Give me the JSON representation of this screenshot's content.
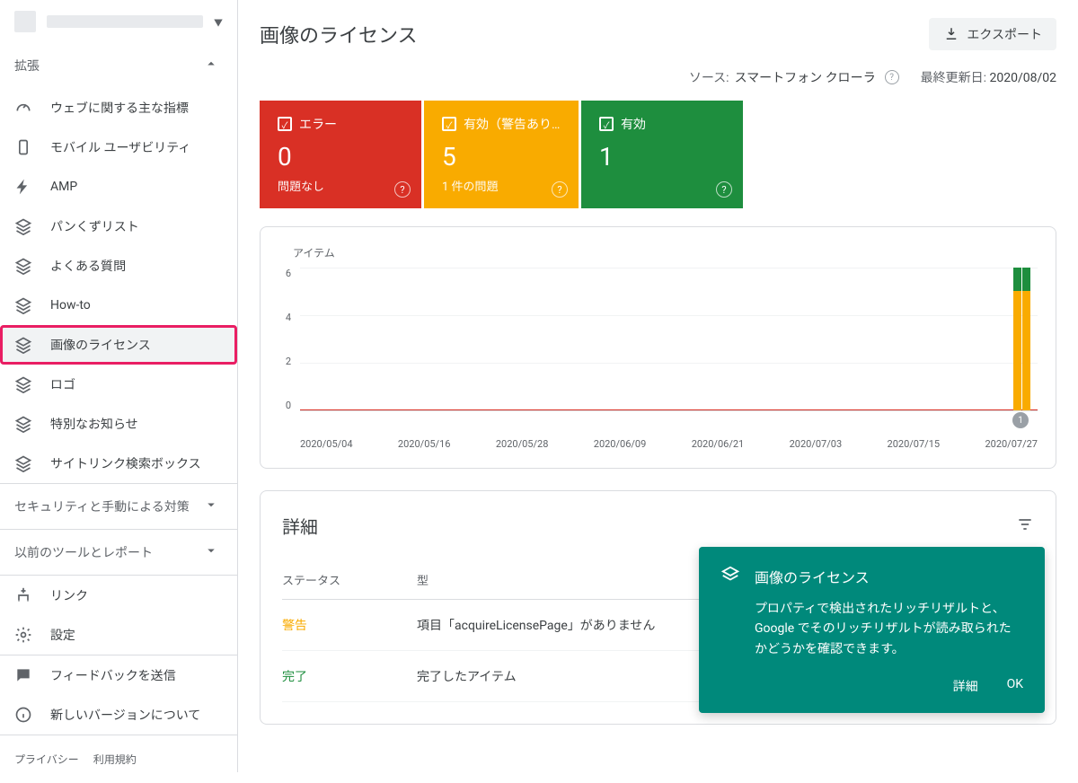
{
  "sidebar": {
    "sections": {
      "enhancements_label": "拡張",
      "security_label": "セキュリティと手動による対策",
      "legacy_label": "以前のツールとレポート"
    },
    "items": [
      {
        "label": "ウェブに関する主な指標"
      },
      {
        "label": "モバイル ユーザビリティ"
      },
      {
        "label": "AMP"
      },
      {
        "label": "パンくずリスト"
      },
      {
        "label": "よくある質問"
      },
      {
        "label": "How-to"
      },
      {
        "label": "画像のライセンス"
      },
      {
        "label": "ロゴ"
      },
      {
        "label": "特別なお知らせ"
      },
      {
        "label": "サイトリンク検索ボックス"
      }
    ],
    "bottom_items": [
      {
        "label": "リンク"
      },
      {
        "label": "設定"
      },
      {
        "label": "フィードバックを送信"
      },
      {
        "label": "新しいバージョンについて"
      }
    ],
    "footer": {
      "privacy": "プライバシー",
      "terms": "利用規約"
    }
  },
  "header": {
    "title": "画像のライセンス",
    "export_label": "エクスポート"
  },
  "meta": {
    "source_label": "ソース:",
    "source_value": "スマートフォン クローラ",
    "updated_label": "最終更新日:",
    "updated_value": "2020/08/02"
  },
  "status_cards": {
    "error": {
      "label": "エラー",
      "value": "0",
      "sub": "問題なし"
    },
    "warning": {
      "label": "有効（警告あり…",
      "value": "5",
      "sub": "1 件の問題"
    },
    "valid": {
      "label": "有効",
      "value": "1",
      "sub": ""
    }
  },
  "chart_data": {
    "type": "bar",
    "ylabel": "アイテム",
    "ylim": [
      0,
      6
    ],
    "yticks": [
      "6",
      "4",
      "2",
      "0"
    ],
    "categories": [
      "2020/05/04",
      "2020/05/16",
      "2020/05/28",
      "2020/06/09",
      "2020/06/21",
      "2020/07/03",
      "2020/07/15",
      "2020/07/27"
    ],
    "series": [
      {
        "name": "エラー",
        "color": "#d93025",
        "values": [
          0,
          0,
          0,
          0,
          0,
          0,
          0,
          0
        ]
      },
      {
        "name": "有効（警告あり）",
        "color": "#f9ab00",
        "values": [
          0,
          0,
          0,
          0,
          0,
          0,
          0,
          5
        ]
      },
      {
        "name": "有効",
        "color": "#1e8e3e",
        "values": [
          0,
          0,
          0,
          0,
          0,
          0,
          0,
          1
        ]
      }
    ],
    "annotation_badge": "1"
  },
  "details": {
    "title": "詳細",
    "columns": {
      "status": "ステータス",
      "type": "型"
    },
    "rows": [
      {
        "status": "警告",
        "status_class": "warning",
        "type": "項目「acquireLicensePage」がありません"
      },
      {
        "status": "完了",
        "status_class": "done",
        "type": "完了したアイテム"
      }
    ]
  },
  "toast": {
    "title": "画像のライセンス",
    "body": "プロパティで検出されたリッチリザルトと、Google でそのリッチリザルトが読み取られたかどうかを確認できます。",
    "details_btn": "詳細",
    "ok_btn": "OK"
  }
}
